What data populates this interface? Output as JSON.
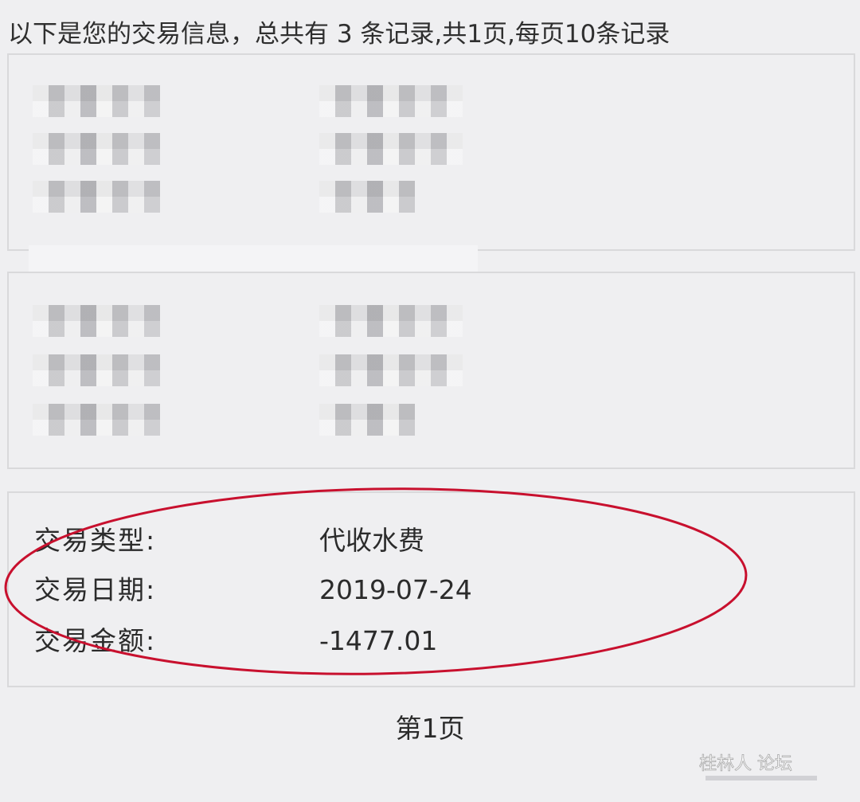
{
  "summary": {
    "text": "以下是您的交易信息，总共有 3 条记录,共1页,每页10条记录"
  },
  "records": [
    {
      "redacted": true
    },
    {
      "redacted": true
    },
    {
      "type_label": "交易类型:",
      "type_value": "代收水费",
      "date_label": "交易日期:",
      "date_value": "2019-07-24",
      "amount_label": "交易金额:",
      "amount_value": "-1477.01"
    }
  ],
  "pagination": {
    "current_page_label": "第1页"
  },
  "watermark": {
    "text": "桂林人 论坛"
  },
  "colors": {
    "background": "#efeff1",
    "card_border": "#d9d9db",
    "highlight_ellipse": "#c8102e",
    "text": "#2b2b2b"
  }
}
